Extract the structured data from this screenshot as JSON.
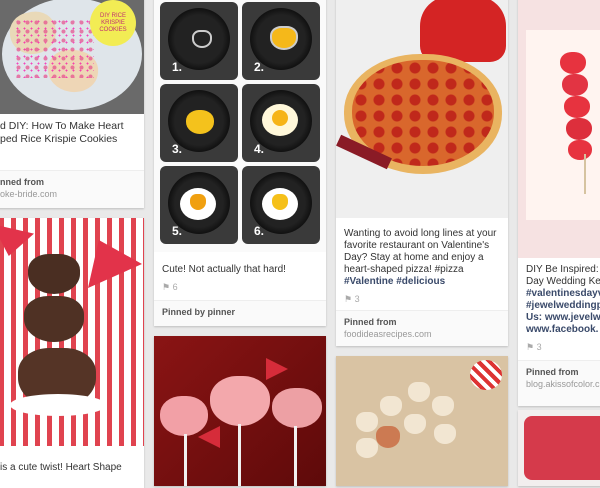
{
  "pins": [
    {
      "id": "pin1",
      "desc_lines": [
        "d DIY: How To Make Heart",
        "ped Rice Krispie Cookies"
      ],
      "via_label": "nned from",
      "via_source": "oke-bride.com",
      "badge": "DIY RICE KRISPIE COOKIES"
    },
    {
      "id": "pin2",
      "desc_lines": [
        "is a cute twist! Heart Shape"
      ]
    },
    {
      "id": "pin3",
      "step_numbers": [
        "1.",
        "2.",
        "3.",
        "4.",
        "5.",
        "6."
      ],
      "desc": "Cute! Not actually that hard!",
      "stats": "⚑ 6",
      "via": "Pinned by pinner"
    },
    {
      "id": "pin5",
      "desc_lines": [
        "Wanting to avoid long lines at your",
        "favorite restaurant on Valentine's",
        "Day? Stay at home and enjoy a",
        "heart-shaped pizza! #pizza",
        "#Valentine #delicious"
      ],
      "stats": "⚑ 3",
      "via_label": "Pinned from",
      "via_source": "foodideasrecipes.com"
    },
    {
      "id": "pin7",
      "desc_lines": [
        "DIY Be Inspired: ",
        "Day Wedding Ke",
        "#valentinesdayv",
        "#jewelweddingp",
        "Us: www.jevelw",
        "www.facebook."
      ],
      "stats": "⚑ 3",
      "via_label": "Pinned from",
      "via_source": "blog.akissofcolor.c"
    }
  ],
  "colors": {
    "background": "#e9e9e9",
    "hashtag": "#3a4a6a",
    "stats": "#aaaaaa"
  }
}
